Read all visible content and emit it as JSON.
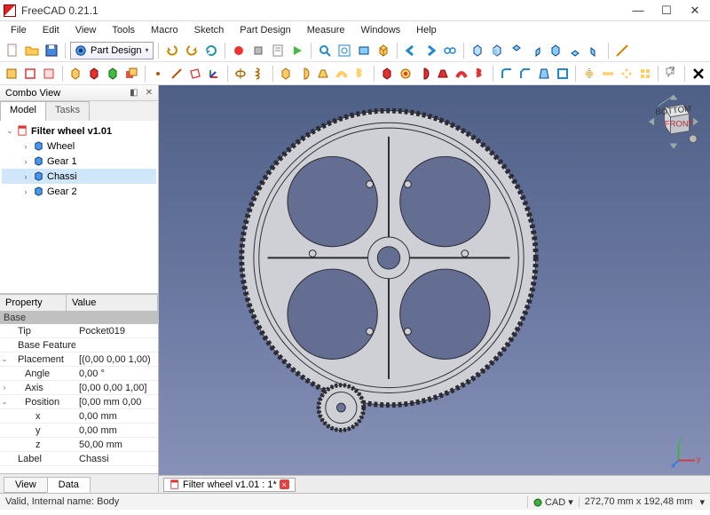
{
  "window": {
    "title": "FreeCAD 0.21.1"
  },
  "menu": [
    "File",
    "Edit",
    "View",
    "Tools",
    "Macro",
    "Sketch",
    "Part Design",
    "Measure",
    "Windows",
    "Help"
  ],
  "workbench": {
    "selected": "Part Design"
  },
  "combo": {
    "title": "Combo View",
    "tabs": [
      "Model",
      "Tasks"
    ],
    "tree": {
      "root": "Filter wheel v1.01",
      "items": [
        "Wheel",
        "Gear 1",
        "Chassi",
        "Gear 2"
      ],
      "selected_index": 2
    }
  },
  "properties": {
    "header": [
      "Property",
      "Value"
    ],
    "category": "Base",
    "rows": [
      {
        "k": "Tip",
        "v": "Pocket019"
      },
      {
        "k": "Base Feature",
        "v": ""
      },
      {
        "k": "Placement",
        "v": "[(0,00 0,00 1,00)",
        "exp": "v"
      },
      {
        "k": "Angle",
        "v": "0,00 °",
        "ind": 1
      },
      {
        "k": "Axis",
        "v": "[0,00 0,00 1,00]",
        "ind": 1,
        "exp": ">"
      },
      {
        "k": "Position",
        "v": "[0,00 mm  0,00",
        "ind": 1,
        "exp": "v"
      },
      {
        "k": "x",
        "v": "0,00 mm",
        "ind": 2
      },
      {
        "k": "y",
        "v": "0,00 mm",
        "ind": 2
      },
      {
        "k": "z",
        "v": "50,00 mm",
        "ind": 2
      },
      {
        "k": "Label",
        "v": "Chassi"
      }
    ],
    "bottom_tabs": [
      "View",
      "Data"
    ],
    "active_bottom_tab": 1
  },
  "doc_tab": "Filter wheel v1.01 : 1*",
  "status": {
    "left": "Valid, Internal name: Body",
    "mode": "CAD",
    "dims": "272,70 mm x 192,48 mm"
  },
  "navcube": {
    "faces": [
      "BOTTOM",
      "FRONT"
    ]
  }
}
